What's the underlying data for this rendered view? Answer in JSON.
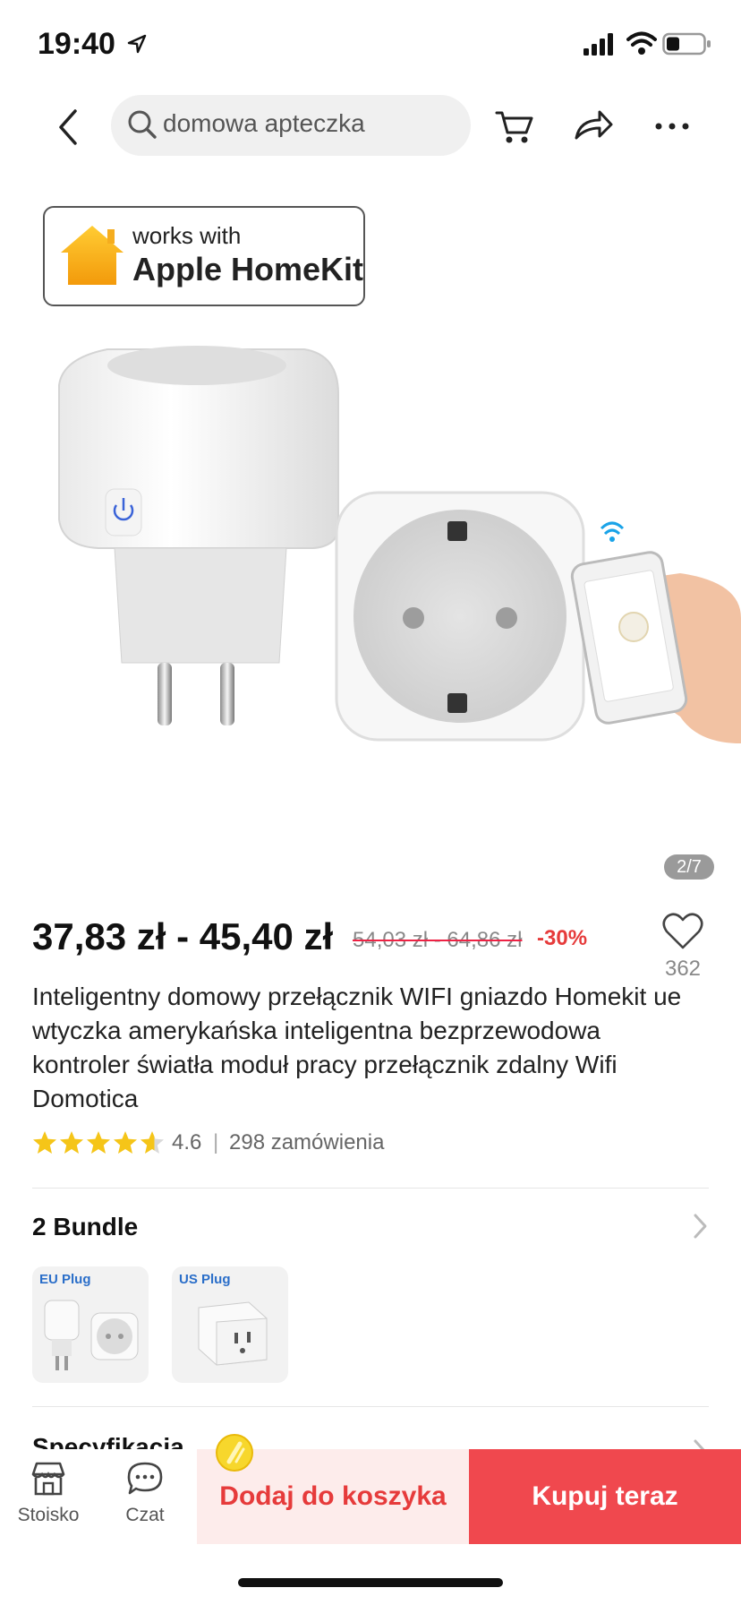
{
  "status": {
    "time": "19:40"
  },
  "search": {
    "query": "domowa apteczka"
  },
  "gallery": {
    "badge_line1": "works with",
    "badge_line2": "Apple HomeKit",
    "page_indicator": "2/7"
  },
  "product": {
    "price": "37,83 zł - 45,40 zł",
    "original_price": "54,03 zł - 64,86 zł",
    "discount": "-30%",
    "likes": "362",
    "title": "Inteligentny domowy przełącznik WIFI gniazdo Homekit ue wtyczka amerykańska inteligentna bezprzewodowa kontroler światła moduł pracy przełącznik zdalny Wifi Domotica",
    "rating": "4.6",
    "rating_stars": 4.6,
    "orders": "298 zamówienia"
  },
  "bundle": {
    "title": "2 Bundle",
    "items": [
      {
        "label": "EU Plug"
      },
      {
        "label": "US Plug"
      }
    ]
  },
  "spec": {
    "title": "Specyfikacja"
  },
  "bottom": {
    "store_label": "Stoisko",
    "chat_label": "Czat",
    "add_to_cart": "Dodaj do koszyka",
    "buy_now": "Kupuj teraz"
  },
  "colors": {
    "accent_red": "#e63b3b",
    "buy_red": "#f0484e",
    "cart_bg": "#fdeceb",
    "star_yellow": "#f5c518"
  },
  "icons": [
    "location-arrow-icon",
    "signal-icon",
    "wifi-icon",
    "battery-icon",
    "back-chevron-icon",
    "search-icon",
    "cart-icon",
    "share-icon",
    "more-icon",
    "heart-icon",
    "star-icon",
    "chevron-right-icon",
    "store-icon",
    "chat-icon",
    "coin-icon"
  ]
}
